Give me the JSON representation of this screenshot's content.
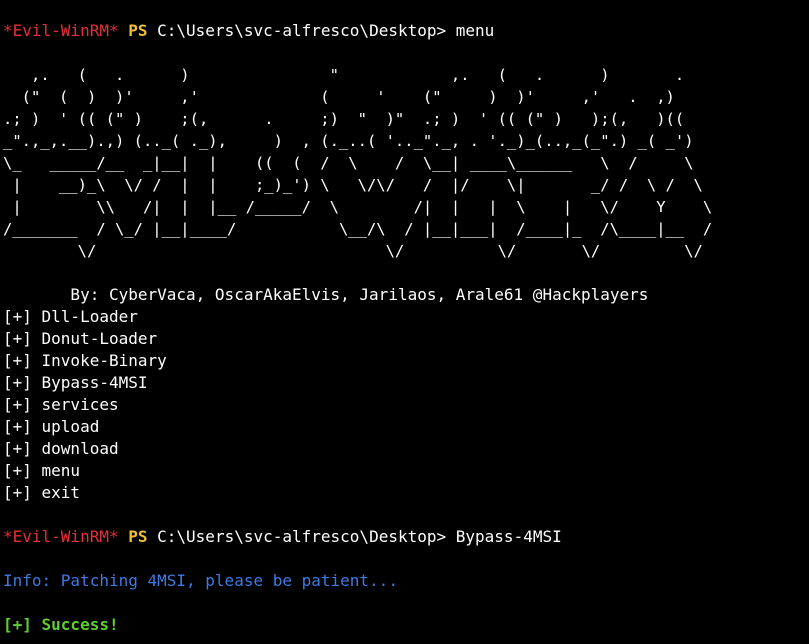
{
  "prompt": {
    "tag": "*Evil-WinRM*",
    "ps": "PS",
    "path": "C:\\Users\\svc-alfresco\\Desktop>"
  },
  "first_command": "menu",
  "banner": [
    "   ,.   (   .      )               \"            ,.   (   .      )       .",
    "  (\"  (  )  )'     ,'             (     '    (\"     )  )'     ,'   .  ,)",
    ".; )  ' (( (\" )    ;(,      .     ;)  \"  )\"  .; )  ' (( (\" )   );(,   )((",
    "_\".,_,.__).,) (.._( ._),     )  , (._..( '.._\"._, . '._)_(..,_(_\".) _( _')",
    "\\_   _____/__  _|__|  |    ((  (  /  \\    /  \\__| ____\\______   \\  /     \\",
    " |    __)_\\  \\/ /  |  |    ;_)_') \\   \\/\\/   /  |/    \\|       _/ /  \\ /  \\",
    " |        \\\\   /|  |  |__ /_____/  \\        /|  |   |  \\    |   \\/    Y    \\",
    "/_______  / \\_/ |__|____/           \\__/\\  / |__|___|  /____|_  /\\____|__  /",
    "        \\/                               \\/          \\/       \\/         \\/"
  ],
  "credits": "       By: CyberVaca, OscarAkaElvis, Jarilaos, Arale61 @Hackplayers",
  "menu_items": [
    "[+] Dll-Loader",
    "[+] Donut-Loader",
    "[+] Invoke-Binary",
    "[+] Bypass-4MSI",
    "[+] services",
    "[+] upload",
    "[+] download",
    "[+] menu",
    "[+] exit"
  ],
  "second_command": "Bypass-4MSI",
  "info_message": "Info: Patching 4MSI, please be patient...",
  "success_message": "[+] Success!",
  "colors": {
    "background": "#000000",
    "evil_tag": "#e5303a",
    "ps_label": "#f0c030",
    "info": "#3f7ae0",
    "success": "#5fcf2f"
  }
}
